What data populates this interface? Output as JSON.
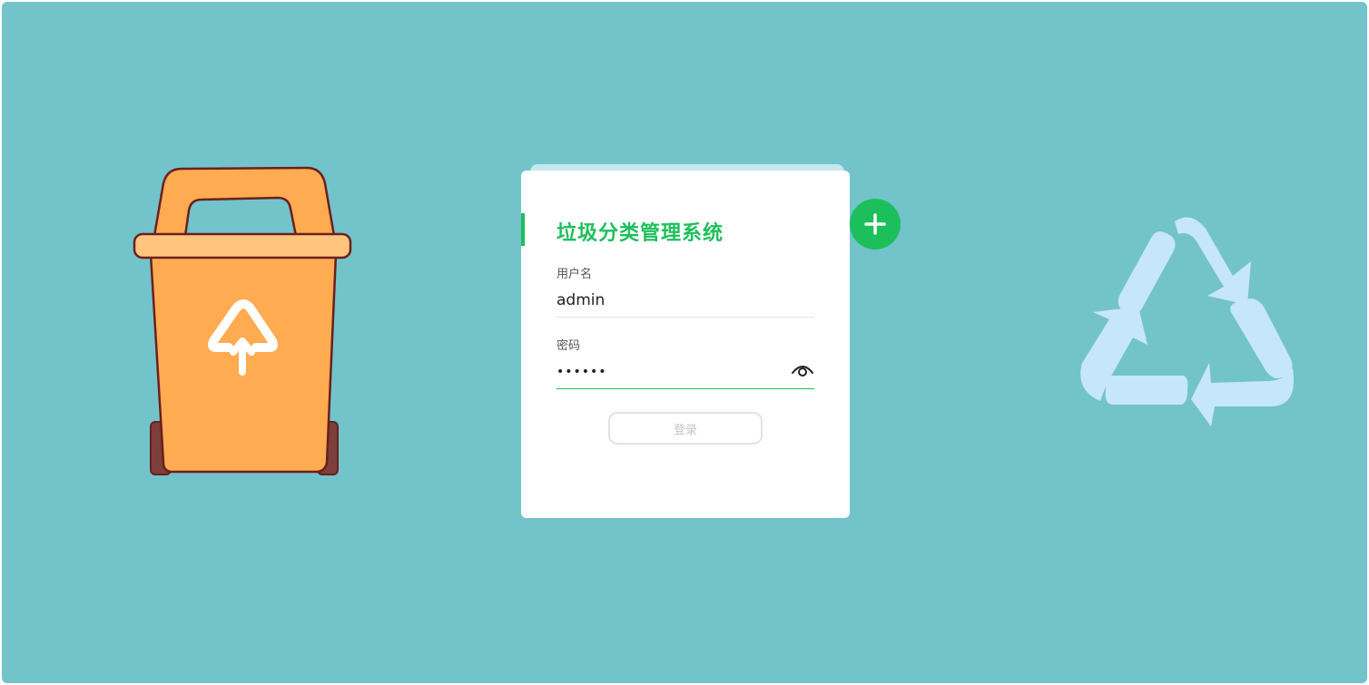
{
  "login": {
    "title": "垃圾分类管理系统",
    "username_label": "用户名",
    "username_value": "admin",
    "password_label": "密码",
    "password_value": "••••••",
    "login_button": "登录"
  },
  "icons": {
    "plus": "plus-icon",
    "eye": "eye-icon",
    "trash_bin": "trash-bin-illustration",
    "recycle": "recycle-symbol"
  },
  "colors": {
    "background": "#72c4ca",
    "accent": "#1dbf5c",
    "bin": "#ffab52",
    "recycle": "#c6e6fb"
  }
}
